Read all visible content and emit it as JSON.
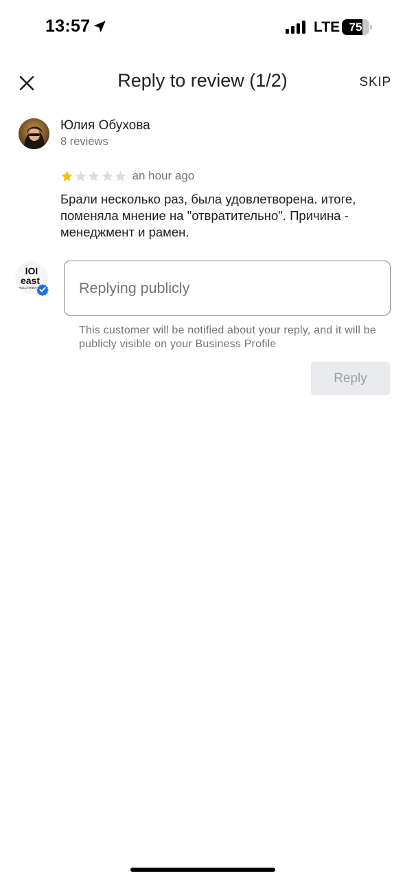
{
  "status_bar": {
    "time": "13:57",
    "network": "LTE",
    "battery": "75",
    "battery_level": 0.75,
    "signal_bars": 4,
    "icons": [
      "location-arrow-icon",
      "signal-icon",
      "battery-icon"
    ]
  },
  "header": {
    "title": "Reply to review (1/2)",
    "skip_label": "SKIP",
    "close_icon": "close-icon"
  },
  "review": {
    "reviewer_name": "Юлия Обухова",
    "reviewer_meta": "8 reviews",
    "rating": 1,
    "max_rating": 5,
    "time": "an hour ago",
    "text": "Брали несколько раз, была удовлетворена.  итоге, поменяла мнение на \"отвратительно\". Причина - менеджмент и рамен.",
    "colors": {
      "star_filled": "#fbbc04",
      "star_empty": "#dadce0"
    }
  },
  "business": {
    "logo_text_top": "IOI",
    "logo_text_mid": "east",
    "logo_text_bottom": "ROLLS'N'BOWLS",
    "verified_icon": "verified-badge-icon"
  },
  "reply": {
    "placeholder": "Replying publicly",
    "value": "",
    "notice": "This customer will be notified about your reply, and it will be publicly visible on your Business Profile",
    "button_label": "Reply",
    "button_enabled": false
  }
}
